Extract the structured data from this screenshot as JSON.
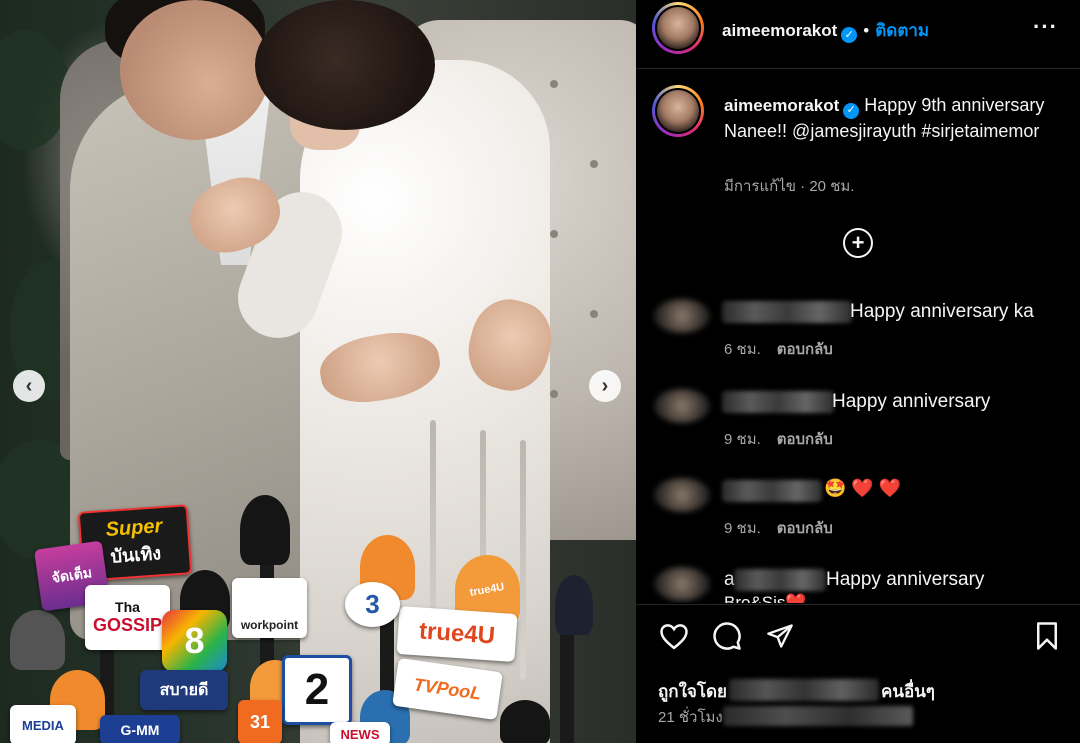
{
  "post": {
    "author": "aimeemorakot",
    "follow_label": "ติดตาม",
    "separator": "•",
    "more_icon": "more-horizontal-icon"
  },
  "caption": {
    "username": "aimeemorakot",
    "text": "Happy 9th anniversary Nanee!! @jamesjirayuth #sirjetaimemor",
    "edited_label": "มีการแก้ไข",
    "time": "20 ชม."
  },
  "load_more_icon": "plus-circle-icon",
  "comments": [
    {
      "text": "Happy anniversary ka",
      "time": "6 ชม.",
      "reply_label": "ตอบกลับ"
    },
    {
      "text": "Happy anniversary",
      "time": "9 ชม.",
      "reply_label": "ตอบกลับ"
    },
    {
      "text": "🤩 ❤️ ❤️",
      "time": "9 ชม.",
      "reply_label": "ตอบกลับ"
    },
    {
      "prefix": "a",
      "text": "Happy anniversary",
      "partial_next_line": "Bro&Sis❤️"
    }
  ],
  "actions": {
    "like_icon": "heart-icon",
    "comment_icon": "comment-icon",
    "share_icon": "send-icon",
    "save_icon": "bookmark-icon"
  },
  "likes": {
    "prefix": "ถูกใจโดย",
    "suffix": "คนอื่นๆ"
  },
  "timestamp": "21 ชั่วโมง",
  "photo": {
    "press_labels": {
      "super": "Super",
      "bunteung": "บันเทิง",
      "jadtem": "จัดเต็ม",
      "thai": "Tha",
      "gossip": "GOSSIP",
      "ch8": "8",
      "workpoint": "workpoint",
      "ch2": "2",
      "true4u": "true4U",
      "true4u_mic": "true4U",
      "tvpool": "TVPooL",
      "news": "NEWS",
      "media": "MEDIA",
      "gmm": "G-MM",
      "sabai": "สบายดี",
      "ch3": "3",
      "ch31": "31"
    }
  }
}
